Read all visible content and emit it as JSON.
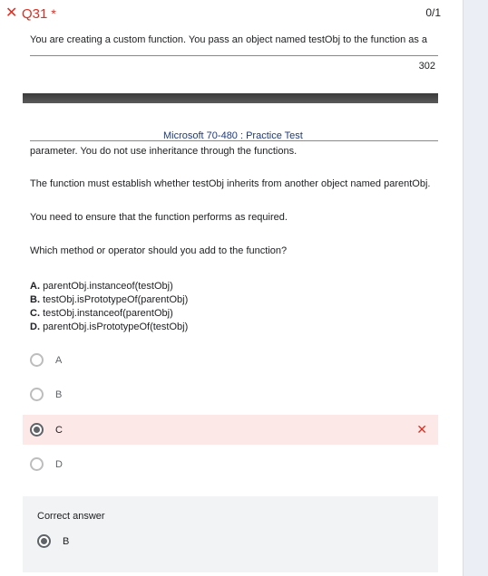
{
  "question": {
    "number_label": "Q31",
    "required_mark": "*",
    "score": "0/1",
    "status_icon": "close-icon"
  },
  "document": {
    "line1": "You are creating a custom function. You pass an object named testObj to the function as a",
    "page_number": "302",
    "title": "Microsoft 70-480 : Practice Test",
    "line2": "parameter. You do not use inheritance through the functions.",
    "line3": "The function must establish whether testObj inherits from another object named parentObj.",
    "line4": "You need to ensure that the function performs as required.",
    "line5": "Which method or operator should you add to the function?",
    "options": [
      {
        "letter": "A.",
        "text": "parentObj.instanceof(testObj)"
      },
      {
        "letter": "B.",
        "text": "testObj.isPrototypeOf(parentObj)"
      },
      {
        "letter": "C.",
        "text": "testObj.instanceof(parentObj)"
      },
      {
        "letter": "D.",
        "text": "parentObj.isPrototypeOf(testObj)"
      }
    ]
  },
  "choices": [
    {
      "label": "A",
      "selected": false
    },
    {
      "label": "B",
      "selected": false
    },
    {
      "label": "C",
      "selected": true,
      "incorrect": true
    },
    {
      "label": "D",
      "selected": false
    }
  ],
  "correct_answer": {
    "title": "Correct answer",
    "label": "B"
  },
  "colors": {
    "error": "#d93025",
    "wrong_bg": "#fce8e6",
    "panel_bg": "#f1f3f4"
  }
}
